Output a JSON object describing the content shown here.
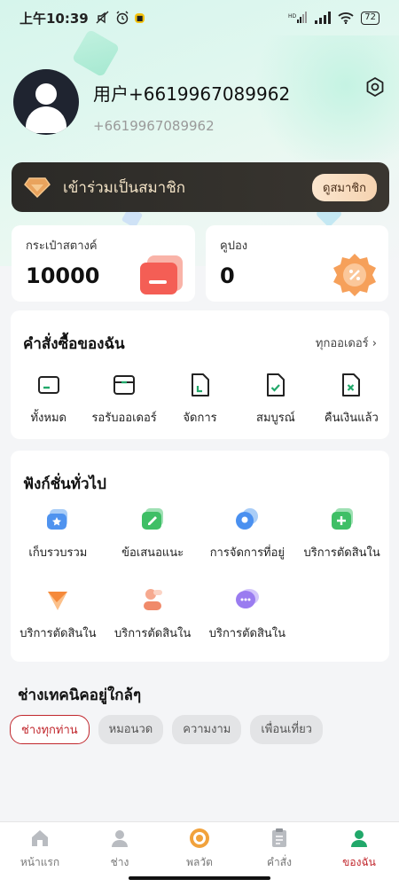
{
  "status_bar": {
    "time": "上午10:39",
    "battery": "72",
    "icons": [
      "mute-icon",
      "alarm-icon",
      "notification-icon",
      "hd-signal-icon",
      "signal-icon",
      "wifi-icon",
      "battery-icon"
    ]
  },
  "profile": {
    "username": "用户+6619967089962",
    "phone": "+6619967089962"
  },
  "membership": {
    "text": "เข้าร่วมเป็นสมาชิก",
    "button": "ดูสมาชิก"
  },
  "wallet": {
    "label": "กระเป๋าสตางค์",
    "value": "10000"
  },
  "coupon": {
    "label": "คูปอง",
    "value": "0"
  },
  "orders": {
    "title": "คำสั่งซื้อของฉัน",
    "link": "ทุกออเดอร์",
    "items": [
      {
        "label": "ทั้งหมด",
        "icon": "card-icon"
      },
      {
        "label": "รอรับออเดอร์",
        "icon": "box-icon"
      },
      {
        "label": "จัดการ",
        "icon": "document-icon"
      },
      {
        "label": "สมบูรณ์",
        "icon": "document-check-icon"
      },
      {
        "label": "คืนเงินแล้ว",
        "icon": "document-x-icon"
      }
    ]
  },
  "functions": {
    "title": "ฟังก์ชั่นทั่วไป",
    "items": [
      {
        "label": "เก็บรวบรวม",
        "icon": "favorites-icon",
        "color": "#5b9ef0"
      },
      {
        "label": "ข้อเสนอแนะ",
        "icon": "feedback-icon",
        "color": "#43c36a"
      },
      {
        "label": "การจัดการที่อยู่",
        "icon": "address-icon",
        "color": "#4a90f0"
      },
      {
        "label": "บริการตัดสินใน",
        "icon": "service-plus-icon",
        "color": "#3fbf66"
      },
      {
        "label": "บริการตัดสินใน",
        "icon": "service-kite-icon",
        "color": "#f59a3d"
      },
      {
        "label": "บริการตัดสินใน",
        "icon": "service-person-icon",
        "color": "#f08a6a"
      },
      {
        "label": "บริการตัดสินใน",
        "icon": "service-chat-icon",
        "color": "#9a7cf0"
      }
    ]
  },
  "nearby": {
    "title": "ช่างเทคนิคอยู่ใกล้ๆ",
    "chips": [
      "ช่างทุกท่าน",
      "หมอนวด",
      "ความงาม",
      "เพื่อนเที่ยว"
    ]
  },
  "tabbar": {
    "items": [
      {
        "label": "หน้าแรก",
        "icon": "home-icon"
      },
      {
        "label": "ช่าง",
        "icon": "technician-icon"
      },
      {
        "label": "พลวัต",
        "icon": "dynamics-icon"
      },
      {
        "label": "คำสั่ง",
        "icon": "orders-icon"
      },
      {
        "label": "ของฉัน",
        "icon": "profile-icon"
      }
    ],
    "active": "ของฉัน"
  },
  "colors": {
    "accent": "#c1272d",
    "green": "#21a86a",
    "member_bg": "#2f2d29"
  }
}
